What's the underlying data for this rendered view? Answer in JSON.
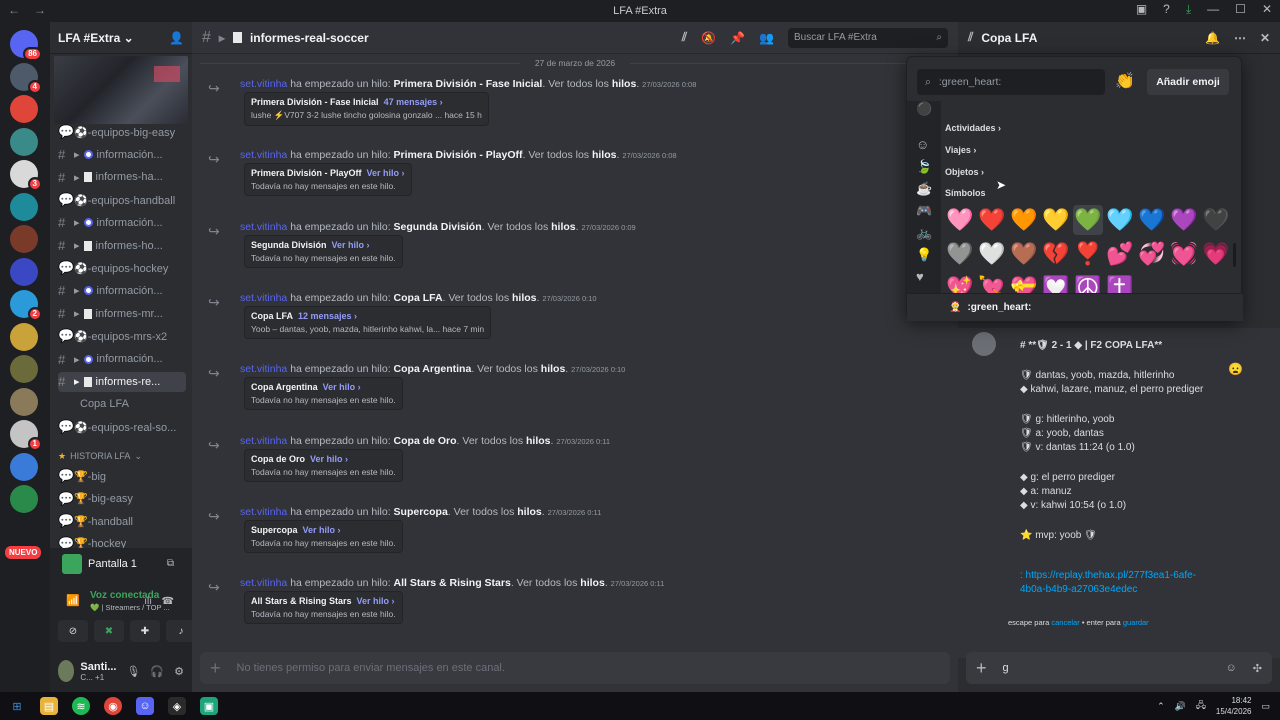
{
  "window": {
    "title": "LFA #Extra"
  },
  "guild": {
    "name": "LFA #Extra"
  },
  "servers": [
    {
      "badge": "86",
      "color": "#5865f2"
    },
    {
      "badge": "4",
      "color": "#4c5a6a"
    },
    {
      "badge": "",
      "color": "#e0453a"
    },
    {
      "badge": "",
      "color": "#3a8a8a"
    },
    {
      "badge": "3",
      "color": "#d9d9d9"
    },
    {
      "badge": "",
      "color": "#1e8b9a"
    },
    {
      "badge": "",
      "color": "#7a3a2a"
    },
    {
      "badge": "",
      "color": "#3a48c4"
    },
    {
      "badge": "2",
      "color": "#2a9ad9"
    },
    {
      "badge": "",
      "color": "#c9a33a"
    },
    {
      "badge": "",
      "color": "#6a6a3a"
    },
    {
      "badge": "",
      "color": "#8a7a5a"
    },
    {
      "badge": "1",
      "color": "#c4c4c4"
    },
    {
      "badge": "",
      "color": "#3a7ad9"
    },
    {
      "badge": "",
      "color": "#2a8a4a"
    }
  ],
  "nuevo_label": "NUEVO",
  "channels": [
    {
      "kind": "forum",
      "label": "⚽-equipos-big-easy",
      "style": ""
    },
    {
      "kind": "text",
      "label": "información...",
      "style": "circle"
    },
    {
      "kind": "text",
      "label": "informes-ha...",
      "style": "square"
    },
    {
      "kind": "forum",
      "label": "⚽-equipos-handball",
      "style": ""
    },
    {
      "kind": "text",
      "label": "información...",
      "style": "circle"
    },
    {
      "kind": "text",
      "label": "informes-ho...",
      "style": "square"
    },
    {
      "kind": "forum",
      "label": "⚽-equipos-hockey",
      "style": ""
    },
    {
      "kind": "text",
      "label": "información...",
      "style": "circle"
    },
    {
      "kind": "text",
      "label": "informes-mr...",
      "style": "square"
    },
    {
      "kind": "forum",
      "label": "⚽-equipos-mrs-x2",
      "style": ""
    },
    {
      "kind": "text",
      "label": "información...",
      "style": "circle"
    },
    {
      "kind": "text",
      "label": "informes-re...",
      "style": "square",
      "active": true
    },
    {
      "kind": "thread",
      "label": "Copa LFA",
      "style": ""
    },
    {
      "kind": "forum",
      "label": "⚽-equipos-real-so...",
      "style": ""
    }
  ],
  "category": {
    "label": "HISTORIA LFA"
  },
  "history_channels": [
    "🏆-big",
    "🏆-big-easy",
    "🏆-handball",
    "🏆-hockey"
  ],
  "voice": {
    "screen": "Pantalla 1",
    "status": "Voz conectada",
    "channel": "💚 | Streamers / TOP ..."
  },
  "user": {
    "name": "Santi...",
    "status": "C... +1"
  },
  "channel": {
    "name": "informes-real-soccer",
    "search_placeholder": "Buscar LFA #Extra"
  },
  "date_divider": "27 de marzo de 2026",
  "messages": [
    {
      "who": "set.vitinha",
      "text": "ha empezado un hilo:",
      "thread": "Primera División - Fase Inicial",
      "see": "Ver todos los",
      "hilos": "hilos",
      "ts": "27/03/2026 0:08",
      "card_title": "Primera División - Fase Inicial",
      "card_link": "47 mensajes ›",
      "card_sub": "lushe  ⚡V707  3-2  lushe tincho golosina gonzalo ...   hace 15 h"
    },
    {
      "who": "set.vitinha",
      "text": "ha empezado un hilo:",
      "thread": "Primera División - PlayOff",
      "see": "Ver todos los",
      "hilos": "hilos",
      "ts": "27/03/2026 0:08",
      "card_title": "Primera División - PlayOff",
      "card_link": "Ver hilo ›",
      "card_sub": "Todavía no hay mensajes en este hilo."
    },
    {
      "who": "set.vitinha",
      "text": "ha empezado un hilo:",
      "thread": "Segunda División",
      "see": "Ver todos los",
      "hilos": "hilos",
      "ts": "27/03/2026 0:09",
      "card_title": "Segunda División",
      "card_link": "Ver hilo ›",
      "card_sub": "Todavía no hay mensajes en este hilo."
    },
    {
      "who": "set.vitinha",
      "text": "ha empezado un hilo:",
      "thread": "Copa LFA",
      "see": "Ver todos los",
      "hilos": "hilos",
      "ts": "27/03/2026 0:10",
      "card_title": "Copa LFA",
      "card_link": "12 mensajes ›",
      "card_sub": "Yoob  –  dantas, yoob, mazda, hitlerinho  kahwi, la...   hace 7 min"
    },
    {
      "who": "set.vitinha",
      "text": "ha empezado un hilo:",
      "thread": "Copa Argentina",
      "see": "Ver todos los",
      "hilos": "hilos",
      "ts": "27/03/2026 0:10",
      "card_title": "Copa Argentina",
      "card_link": "Ver hilo ›",
      "card_sub": "Todavía no hay mensajes en este hilo."
    },
    {
      "who": "set.vitinha",
      "text": "ha empezado un hilo:",
      "thread": "Copa de Oro",
      "see": "Ver todos los",
      "hilos": "hilos",
      "ts": "27/03/2026 0:11",
      "card_title": "Copa de Oro",
      "card_link": "Ver hilo ›",
      "card_sub": "Todavía no hay mensajes en este hilo."
    },
    {
      "who": "set.vitinha",
      "text": "ha empezado un hilo:",
      "thread": "Supercopa",
      "see": "Ver todos los",
      "hilos": "hilos",
      "ts": "27/03/2026 0:11",
      "card_title": "Supercopa",
      "card_link": "Ver hilo ›",
      "card_sub": "Todavía no hay mensajes en este hilo."
    },
    {
      "who": "set.vitinha",
      "text": "ha empezado un hilo:",
      "thread": "All Stars & Rising Stars",
      "see": "Ver todos los",
      "hilos": "hilos",
      "ts": "27/03/2026 0:11",
      "card_title": "All Stars & Rising Stars",
      "card_link": "Ver hilo ›",
      "card_sub": "Todavía no hay mensajes en este hilo."
    }
  ],
  "composer": {
    "placeholder": "No tienes permiso para enviar mensajes en este canal."
  },
  "thread_panel": {
    "title": "Copa LFA",
    "lines": [
      {
        "text": "# **🛡 2 - 1 ◆ | F2 COPA LFA**",
        "bold": true
      },
      {
        "text": "🛡 dantas, yoob, mazda, hitlerinho"
      },
      {
        "text": "◆ kahwi, lazare, manuz, el perro prediger"
      },
      {
        "text": "🛡 g: hitlerinho, yoob"
      },
      {
        "text": "🛡 a: yoob, dantas"
      },
      {
        "text": "🛡 v: dantas 11:24 (o 1.0)"
      },
      {
        "text": "◆ g: el perro prediger"
      },
      {
        "text": "◆ a: manuz"
      },
      {
        "text": "◆ v: kahwi 10:54 (o 1.0)"
      },
      {
        "text": "⭐ mvp: yoob 🛡"
      },
      {
        "text": ": https://replay.thehax.pl/277f3ea1-6afe-"
      },
      {
        "text": "4b0a-b4b9-a27063e4edec"
      }
    ],
    "footer_pre": "escape para",
    "footer_cancel": "cancelar",
    "footer_mid": "• enter para",
    "footer_save": "guardar",
    "composer_value": "g"
  },
  "emoji_picker": {
    "search_value": ":green_heart:",
    "add_label": "Añadir emoji",
    "categories": [
      "Actividades ›",
      "Viajes ›",
      "Objetos ›",
      "Símbolos"
    ],
    "hearts": [
      "🩷",
      "❤️",
      "🧡",
      "💛",
      "💚",
      "🩵",
      "💙",
      "💜",
      "🖤",
      "🩶",
      "🤍",
      "🤎",
      "💔",
      "❣️",
      "💕",
      "💞",
      "💓",
      "💗",
      "💖",
      "💘",
      "💝",
      "💟",
      "☮️",
      "✝️"
    ],
    "selected_index": 4,
    "footer_label": ":green_heart:"
  },
  "taskbar": {
    "time": "18:42",
    "date": "15/4/2026"
  }
}
